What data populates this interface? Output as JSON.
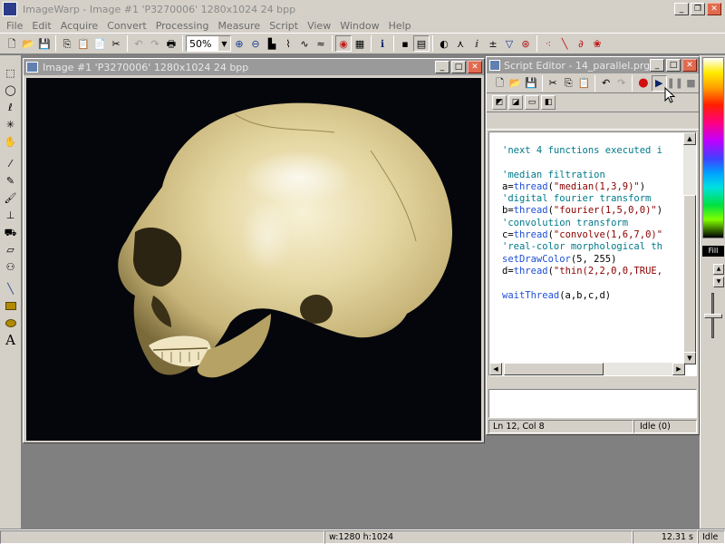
{
  "app": {
    "title": "ImageWarp - Image #1  'P3270006'  1280x1024  24  bpp"
  },
  "menu": [
    "File",
    "Edit",
    "Acquire",
    "Convert",
    "Processing",
    "Measure",
    "Script",
    "View",
    "Window",
    "Help"
  ],
  "toolbar": {
    "zoom_value": "50%"
  },
  "image_window": {
    "title": "Image #1  'P3270006'  1280x1024  24  bpp"
  },
  "script_editor": {
    "title": "Script Editor - 14_parallel.prg",
    "code": [
      [
        {
          "t": "'next 4 functions executed i",
          "c": "c-comment"
        }
      ],
      [
        {
          "t": "",
          "c": "c-plain"
        }
      ],
      [
        {
          "t": "'median filtration",
          "c": "c-comment"
        }
      ],
      [
        {
          "t": "a=",
          "c": "c-plain"
        },
        {
          "t": "thread",
          "c": "c-kw"
        },
        {
          "t": "(",
          "c": "c-plain"
        },
        {
          "t": "\"median(1,3,9)\"",
          "c": "c-str"
        },
        {
          "t": ")",
          "c": "c-plain"
        }
      ],
      [
        {
          "t": "'digital fourier transform",
          "c": "c-comment"
        }
      ],
      [
        {
          "t": "b=",
          "c": "c-plain"
        },
        {
          "t": "thread",
          "c": "c-kw"
        },
        {
          "t": "(",
          "c": "c-plain"
        },
        {
          "t": "\"fourier(1,5,0,0)\"",
          "c": "c-str"
        },
        {
          "t": ")",
          "c": "c-plain"
        }
      ],
      [
        {
          "t": "'convolution transform",
          "c": "c-comment"
        }
      ],
      [
        {
          "t": "c=",
          "c": "c-plain"
        },
        {
          "t": "thread",
          "c": "c-kw"
        },
        {
          "t": "(",
          "c": "c-plain"
        },
        {
          "t": "\"convolve(1,6,7,0)\"",
          "c": "c-str"
        }
      ],
      [
        {
          "t": "'real-color morphological th",
          "c": "c-comment"
        }
      ],
      [
        {
          "t": "setDrawColor",
          "c": "c-kw"
        },
        {
          "t": "(5, 255)",
          "c": "c-plain"
        }
      ],
      [
        {
          "t": "d=",
          "c": "c-plain"
        },
        {
          "t": "thread",
          "c": "c-kw"
        },
        {
          "t": "(",
          "c": "c-plain"
        },
        {
          "t": "\"thin(2,2,0,0,TRUE,",
          "c": "c-str"
        }
      ],
      [
        {
          "t": "",
          "c": "c-plain"
        }
      ],
      [
        {
          "t": "waitThread",
          "c": "c-kw"
        },
        {
          "t": "(a,b,c,d)",
          "c": "c-plain"
        }
      ]
    ],
    "status_pos": "Ln 12, Col 8",
    "status_state": "Idle  (0)"
  },
  "palette": {
    "fill_label": "Fill"
  },
  "statusbar": {
    "dims": "w:1280  h:1024",
    "time": "12.31 s",
    "state": "Idle"
  },
  "colors": {
    "titlebar_active": "#0a246a",
    "titlebar_inactive": "#9a9a9a",
    "face": "#d4d0c8",
    "workspace": "#808080"
  }
}
